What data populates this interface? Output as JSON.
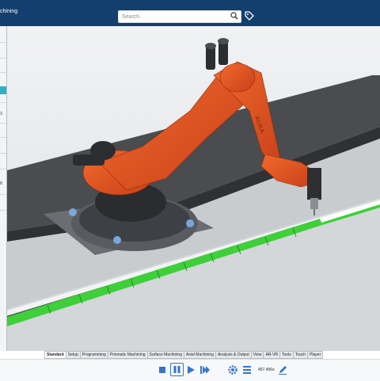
{
  "app": {
    "title": "chining"
  },
  "search": {
    "placeholder": "Search"
  },
  "left_panel": {
    "numbers": [
      "3",
      "8"
    ]
  },
  "viewport": {
    "robot_brand": "KUKA"
  },
  "tabs": [
    {
      "label": "Standard",
      "active": true
    },
    {
      "label": "Setup",
      "active": false
    },
    {
      "label": "Programming",
      "active": false
    },
    {
      "label": "Prismatic Machining",
      "active": false
    },
    {
      "label": "Surface Machining",
      "active": false
    },
    {
      "label": "Axial Machining",
      "active": false
    },
    {
      "label": "Analysis & Output",
      "active": false
    },
    {
      "label": "View",
      "active": false
    },
    {
      "label": "AR-VR",
      "active": false
    },
    {
      "label": "Tools",
      "active": false
    },
    {
      "label": "Touch",
      "active": false
    },
    {
      "label": "Player",
      "active": false
    }
  ],
  "player": {
    "time": "457.456s",
    "buttons": [
      "stop-icon",
      "pause-icon",
      "play-icon",
      "fast-forward-icon",
      "settings-icon",
      "list-icon",
      "edit-icon"
    ]
  },
  "colors": {
    "topbar": "#123f6e",
    "robot": "#e8531e",
    "track": "#3fcf3a",
    "highlight": "#2fb0c4"
  }
}
